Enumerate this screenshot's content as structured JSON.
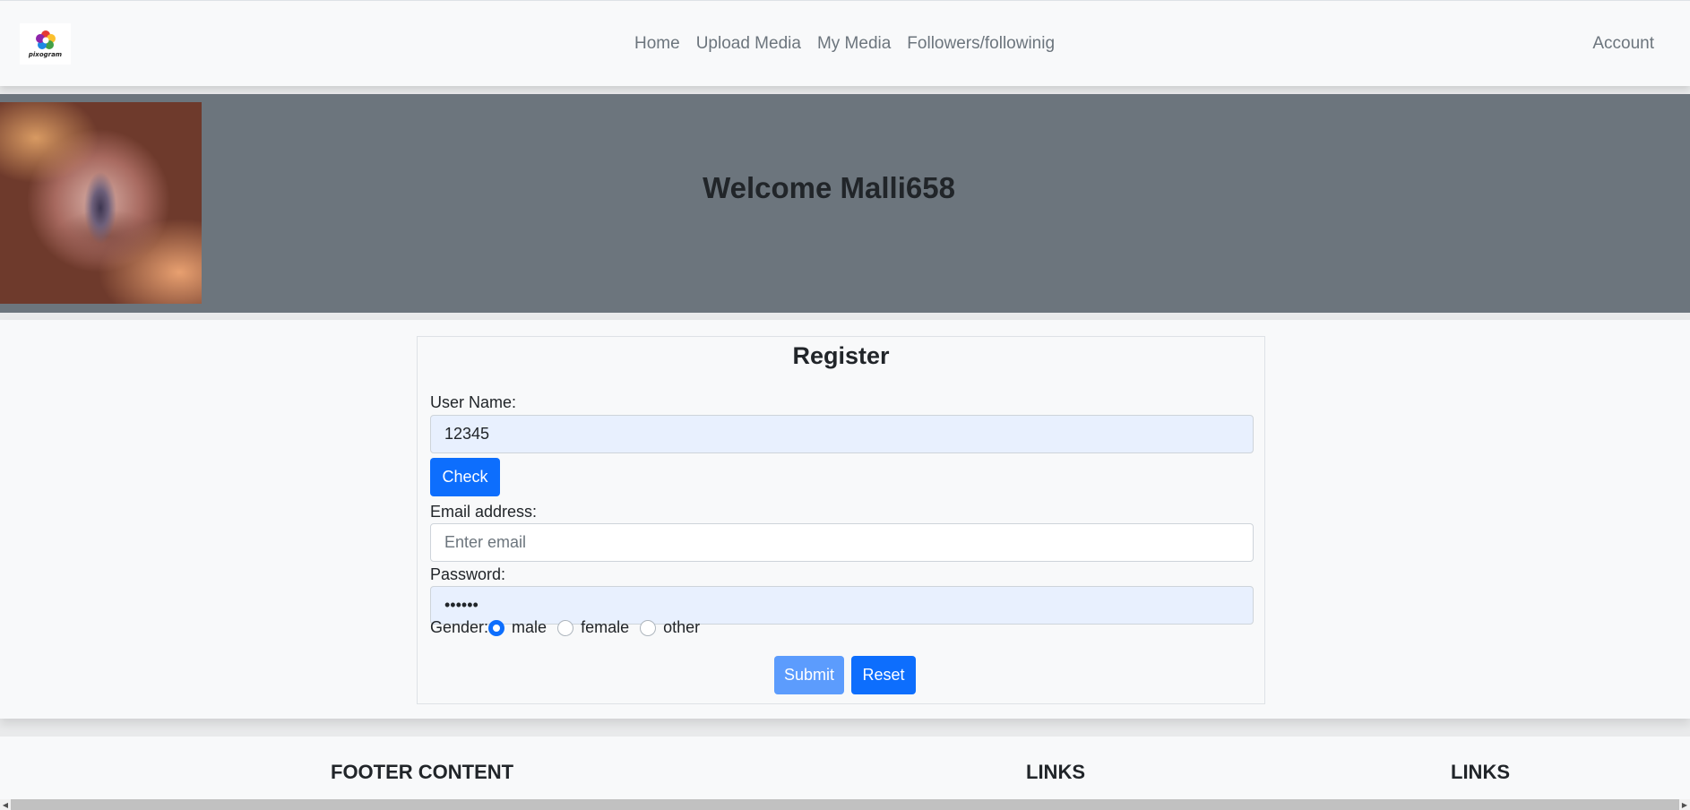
{
  "brand": {
    "logo_text": "pixogram"
  },
  "nav": {
    "items": [
      "Home",
      "Upload Media",
      "My Media",
      "Followers/followinig"
    ],
    "account": "Account"
  },
  "hero": {
    "title": "Welcome Malli658"
  },
  "register": {
    "title": "Register",
    "username_label": "User Name:",
    "username_value": "12345",
    "check_label": "Check",
    "email_label": "Email address:",
    "email_placeholder": "Enter email",
    "email_value": "",
    "password_label": "Password:",
    "password_value": "••••••",
    "gender_label": "Gender:",
    "gender_options": [
      "male",
      "female",
      "other"
    ],
    "gender_selected": "male",
    "submit_label": "Submit",
    "reset_label": "Reset"
  },
  "footer": {
    "col1": "FOOTER CONTENT",
    "col2": "LINKS",
    "col3": "LINKS"
  },
  "colors": {
    "primary": "#0d6efd",
    "hero_bg": "#6c757d",
    "autofill_bg": "#e8f0fe"
  }
}
